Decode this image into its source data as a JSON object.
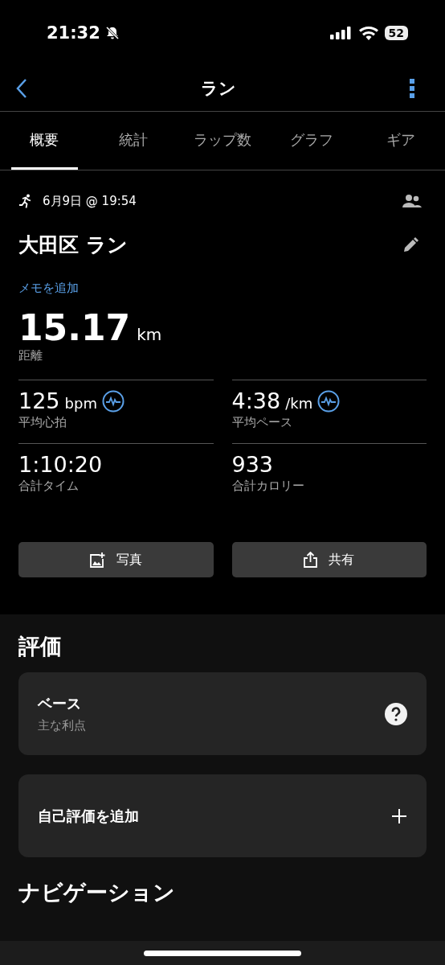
{
  "status_bar": {
    "time": "21:32",
    "silent": true,
    "battery": "52"
  },
  "nav": {
    "title": "ラン"
  },
  "tabs": [
    {
      "label": "概要",
      "selected": true
    },
    {
      "label": "統計",
      "selected": false
    },
    {
      "label": "ラップ数",
      "selected": false
    },
    {
      "label": "グラフ",
      "selected": false
    },
    {
      "label": "ギア",
      "selected": false
    }
  ],
  "activity": {
    "datetime": "6月9日 @ 19:54",
    "name": "大田区 ラン",
    "add_note": "メモを追加",
    "distance": "15.17",
    "distance_unit": "km",
    "distance_label": "距離"
  },
  "stats": [
    {
      "value": "125",
      "unit": "bpm",
      "label": "平均心拍",
      "graph_icon": true
    },
    {
      "value": "4:38",
      "unit": "/km",
      "label": "平均ペース",
      "graph_icon": true
    },
    {
      "value": "1:10:20",
      "label": "合計タイム",
      "graph_icon": false
    },
    {
      "value": "933",
      "label": "合計カロリー",
      "graph_icon": false
    }
  ],
  "actions": [
    {
      "kind": "photo",
      "label": "写真"
    },
    {
      "kind": "share",
      "label": "共有"
    }
  ],
  "rating": {
    "heading": "評価",
    "cards": [
      {
        "kind": "info",
        "title": "ベース",
        "subtitle": "主な利点"
      },
      {
        "kind": "add",
        "title": "自己評価を追加"
      }
    ]
  },
  "next_heading": "ナビゲーション"
}
